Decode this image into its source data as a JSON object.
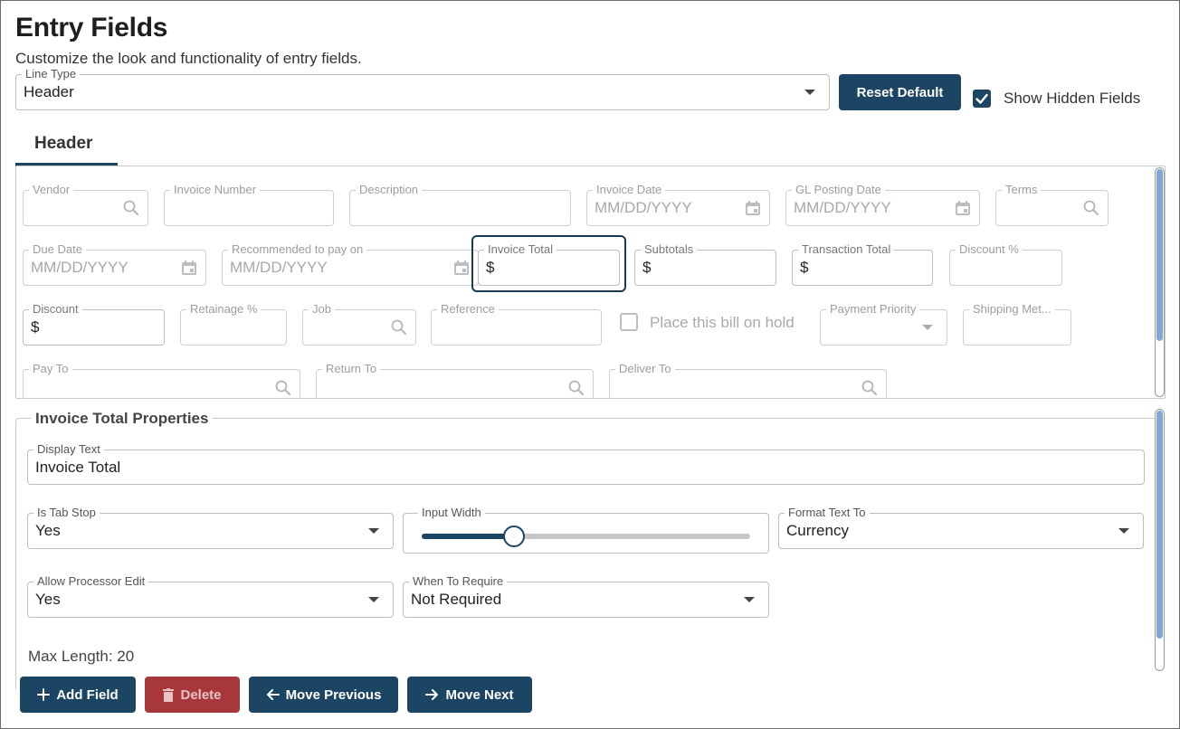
{
  "header": {
    "title": "Entry Fields",
    "subtitle": "Customize the look and functionality of entry fields."
  },
  "line_type": {
    "label": "Line Type",
    "value": "Header"
  },
  "reset_button": "Reset Default",
  "show_hidden": {
    "label": "Show Hidden Fields",
    "checked": true
  },
  "tab": {
    "label": "Header"
  },
  "fields": {
    "vendor": {
      "label": "Vendor"
    },
    "invoice_number": {
      "label": "Invoice Number"
    },
    "description": {
      "label": "Description"
    },
    "invoice_date": {
      "label": "Invoice Date",
      "placeholder": "MM/DD/YYYY"
    },
    "gl_posting_date": {
      "label": "GL Posting Date",
      "placeholder": "MM/DD/YYYY"
    },
    "terms": {
      "label": "Terms"
    },
    "due_date": {
      "label": "Due Date",
      "placeholder": "MM/DD/YYYY"
    },
    "recommended_pay": {
      "label": "Recommended to pay on",
      "placeholder": "MM/DD/YYYY"
    },
    "invoice_total": {
      "label": "Invoice Total",
      "value": "$"
    },
    "subtotals": {
      "label": "Subtotals",
      "value": "$"
    },
    "transaction_total": {
      "label": "Transaction Total",
      "value": "$"
    },
    "discount_pct": {
      "label": "Discount %"
    },
    "discount": {
      "label": "Discount",
      "value": "$"
    },
    "retainage_pct": {
      "label": "Retainage %"
    },
    "job": {
      "label": "Job"
    },
    "reference": {
      "label": "Reference"
    },
    "hold": {
      "label": "Place this bill on hold",
      "checked": false
    },
    "payment_priority": {
      "label": "Payment Priority"
    },
    "shipping_method": {
      "label": "Shipping Met..."
    },
    "pay_to": {
      "label": "Pay To"
    },
    "return_to": {
      "label": "Return To"
    },
    "deliver_to": {
      "label": "Deliver To"
    }
  },
  "properties": {
    "title": "Invoice Total Properties",
    "display_text": {
      "label": "Display Text",
      "value": "Invoice Total"
    },
    "is_tab_stop": {
      "label": "Is Tab Stop",
      "value": "Yes"
    },
    "input_width": {
      "label": "Input Width",
      "level_percent": 28
    },
    "format_text_to": {
      "label": "Format Text To",
      "value": "Currency"
    },
    "allow_processor_edit": {
      "label": "Allow Processor Edit",
      "value": "Yes"
    },
    "when_to_require": {
      "label": "When To Require",
      "value": "Not Required"
    },
    "max_length": "Max Length: 20"
  },
  "actions": {
    "add_field": "Add Field",
    "delete": "Delete",
    "move_previous": "Move Previous",
    "move_next": "Move Next"
  },
  "icons": {
    "search": "search-icon",
    "calendar": "calendar-icon",
    "dropdown": "chevron-down-icon",
    "check": "check-icon",
    "plus": "plus-icon",
    "trash": "trash-icon",
    "arrow_left": "arrow-left-icon",
    "arrow_right": "arrow-right-icon"
  },
  "colors": {
    "primary": "#1c4463",
    "danger": "#a8373b",
    "scroll_thumb": "#7fa7d8"
  }
}
